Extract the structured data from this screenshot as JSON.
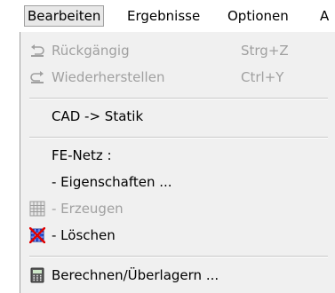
{
  "menubar": {
    "items": [
      {
        "label": "Bearbeiten"
      },
      {
        "label": "Ergebnisse"
      },
      {
        "label": "Optionen"
      },
      {
        "label": "A"
      }
    ]
  },
  "menu": {
    "undo": {
      "label": "Rückgängig",
      "shortcut": "Strg+Z",
      "icon": "undo-icon"
    },
    "redo": {
      "label": "Wiederherstellen",
      "shortcut": "Ctrl+Y",
      "icon": "redo-icon"
    },
    "cad_statik": {
      "label": "CAD -> Statik"
    },
    "fe_netz": {
      "label": "FE-Netz :"
    },
    "eigenschaften": {
      "label": "- Eigenschaften ..."
    },
    "erzeugen": {
      "label": "- Erzeugen",
      "icon": "mesh-grid-icon"
    },
    "loeschen": {
      "label": "- Löschen",
      "icon": "delete-mesh-icon"
    },
    "berechnen": {
      "label": "Berechnen/Überlagern ...",
      "icon": "calculator-icon"
    }
  },
  "colors": {
    "disabled": "#a0a0a0",
    "menu_bg": "#f0f0f0",
    "delete_red": "#e00000",
    "mesh_blue": "#2a4fd0"
  }
}
